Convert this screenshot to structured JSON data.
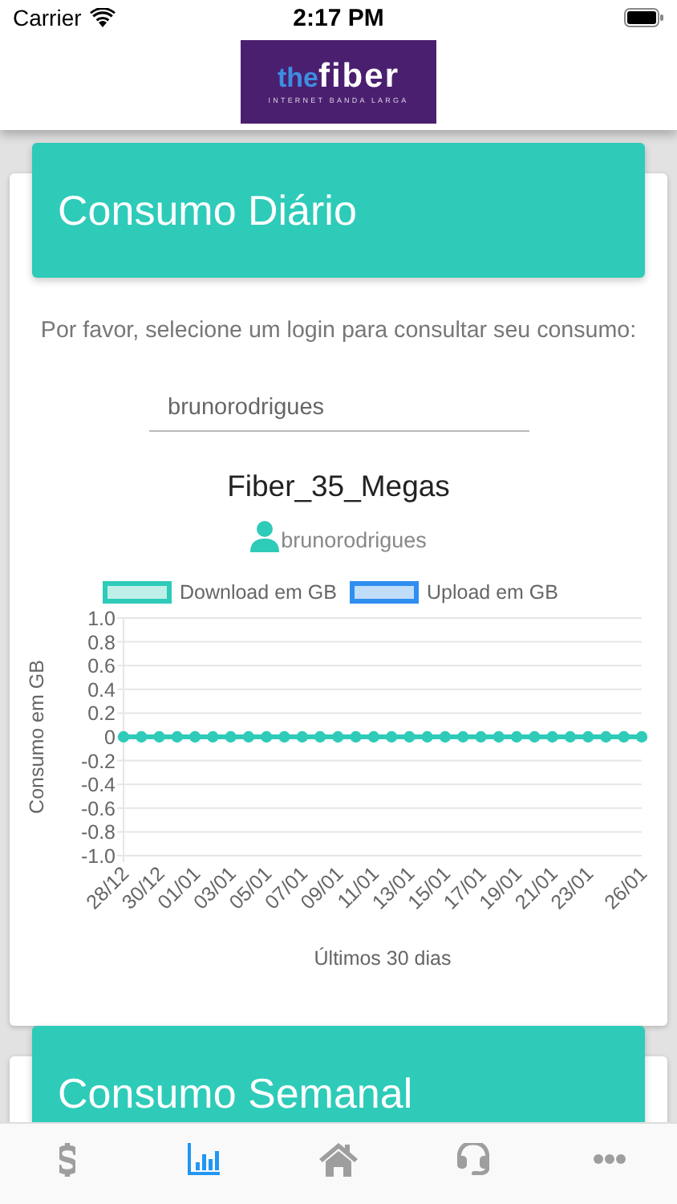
{
  "status_bar": {
    "carrier": "Carrier",
    "time": "2:17 PM"
  },
  "header": {
    "logo": {
      "brand_light": "the",
      "brand_bold": "fiber",
      "tagline": "INTERNET BANDA LARGA"
    }
  },
  "cards": [
    {
      "title": "Consumo Diário",
      "instruction": "Por favor, selecione um login para consultar seu consumo:",
      "login_field": {
        "value": "brunorodrigues"
      },
      "plan": "Fiber_35_Megas",
      "user": "brunorodrigues",
      "chart_data": {
        "type": "line",
        "xlabel": "Últimos 30 dias",
        "ylabel": "Consumo em GB",
        "categories": [
          "28/12",
          null,
          "30/12",
          null,
          "01/01",
          null,
          "03/01",
          null,
          "05/01",
          null,
          "07/01",
          null,
          "09/01",
          null,
          "11/01",
          null,
          "13/01",
          null,
          "15/01",
          null,
          "17/01",
          null,
          "19/01",
          null,
          "21/01",
          null,
          "23/01",
          null,
          null,
          "26/01"
        ],
        "grid": true,
        "legend": true,
        "series": [
          {
            "name": "Download em GB",
            "color": "#2ecbb9",
            "marker": "circle",
            "values": [
              0,
              0,
              0,
              0,
              0,
              0,
              0,
              0,
              0,
              0,
              0,
              0,
              0,
              0,
              0,
              0,
              0,
              0,
              0,
              0,
              0,
              0,
              0,
              0,
              0,
              0,
              0,
              0,
              0,
              0
            ]
          },
          {
            "name": "Upload em GB",
            "color": "#2f8ef0",
            "values": [
              null,
              null,
              null,
              null,
              null,
              null,
              null,
              null,
              null,
              null,
              null,
              null,
              null,
              null,
              null,
              null,
              null,
              null,
              null,
              null,
              null,
              null,
              null,
              null,
              null,
              null,
              null,
              null,
              null,
              null
            ]
          }
        ],
        "ylim": [
          -1,
          1
        ],
        "yticks": [
          {
            "value": 1,
            "label": "1.0"
          },
          {
            "value": 0.8,
            "label": "0.8"
          },
          {
            "value": 0.6,
            "label": "0.6"
          },
          {
            "value": 0.4,
            "label": "0.4"
          },
          {
            "value": 0.2,
            "label": "0.2"
          },
          {
            "value": 0,
            "label": "0"
          },
          {
            "value": -0.2,
            "label": "-0.2"
          },
          {
            "value": -0.4,
            "label": "-0.4"
          },
          {
            "value": -0.6,
            "label": "-0.6"
          },
          {
            "value": -0.8,
            "label": "-0.8"
          },
          {
            "value": -1,
            "label": "-1.0"
          }
        ]
      }
    },
    {
      "title": "Consumo Semanal"
    }
  ],
  "tab_bar": [
    {
      "kind": "dollar",
      "selected": false
    },
    {
      "kind": "chart",
      "selected": true
    },
    {
      "kind": "home",
      "selected": false
    },
    {
      "kind": "support",
      "selected": false
    },
    {
      "kind": "more",
      "selected": false
    }
  ]
}
